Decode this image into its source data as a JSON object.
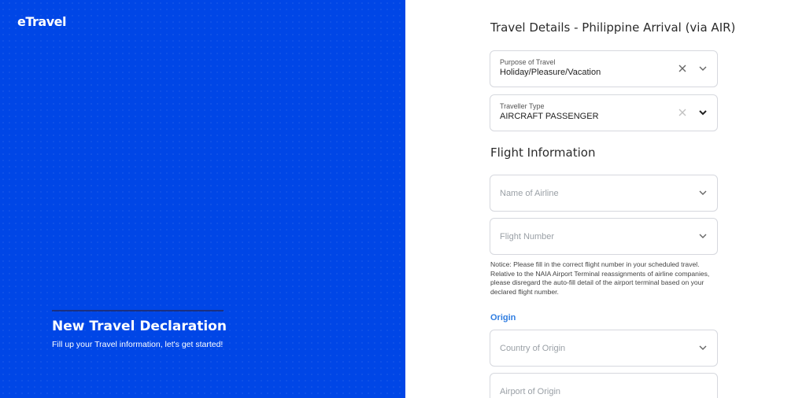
{
  "brand": {
    "logo": "eTravel"
  },
  "hero": {
    "title": "New Travel Declaration",
    "subtitle": "Fill up your Travel information, let's get started!"
  },
  "form": {
    "title": "Travel Details - Philippine Arrival (via AIR)",
    "purpose": {
      "label": "Purpose of Travel",
      "value": "Holiday/Pleasure/Vacation"
    },
    "traveller_type": {
      "label": "Traveller Type",
      "value": "AIRCRAFT PASSENGER"
    },
    "flight_section_title": "Flight Information",
    "airline": {
      "placeholder": "Name of Airline"
    },
    "flight_number": {
      "placeholder": "Flight Number"
    },
    "notice": "Notice: Please fill in the correct flight number in your scheduled travel. Relative to the NAIA Airport Terminal reassignments of airline companies, please disregard the auto-fill detail of the airport terminal based on your declared flight number.",
    "origin_label": "Origin",
    "country_of_origin": {
      "placeholder": "Country of Origin"
    },
    "airport_of_origin": {
      "placeholder": "Airport of Origin"
    }
  },
  "colors": {
    "brand_blue": "#0046e6",
    "link_blue": "#2f7de1",
    "border": "#d6d8de"
  },
  "icons": [
    "close-icon",
    "chevron-down-icon"
  ]
}
